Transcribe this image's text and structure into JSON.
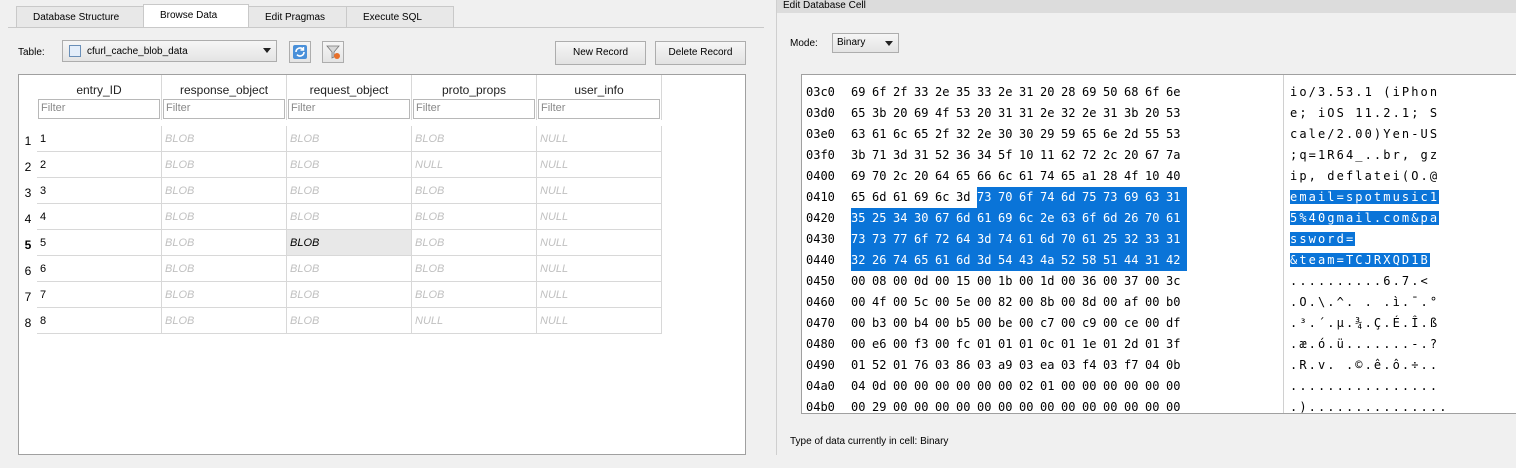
{
  "tabs": [
    "Database Structure",
    "Browse Data",
    "Edit Pragmas",
    "Execute SQL"
  ],
  "active_tab": 1,
  "toolbar": {
    "table_label": "Table:",
    "table_value": "cfurl_cache_blob_data",
    "new_record": "New Record",
    "delete_record": "Delete Record"
  },
  "grid": {
    "columns": [
      "entry_ID",
      "response_object",
      "request_object",
      "proto_props",
      "user_info"
    ],
    "filter_placeholder": "Filter",
    "rows": [
      [
        "1",
        "BLOB",
        "BLOB",
        "BLOB",
        "NULL"
      ],
      [
        "2",
        "BLOB",
        "BLOB",
        "NULL",
        "NULL"
      ],
      [
        "3",
        "BLOB",
        "BLOB",
        "BLOB",
        "NULL"
      ],
      [
        "4",
        "BLOB",
        "BLOB",
        "BLOB",
        "NULL"
      ],
      [
        "5",
        "BLOB",
        "BLOB",
        "BLOB",
        "NULL"
      ],
      [
        "6",
        "BLOB",
        "BLOB",
        "BLOB",
        "NULL"
      ],
      [
        "7",
        "BLOB",
        "BLOB",
        "BLOB",
        "NULL"
      ],
      [
        "8",
        "BLOB",
        "BLOB",
        "NULL",
        "NULL"
      ]
    ],
    "row_numbers": [
      "1",
      "2",
      "3",
      "4",
      "5",
      "6",
      "7",
      "8"
    ],
    "current_row": 4,
    "selected_cell": {
      "row": 4,
      "col": 2
    }
  },
  "edit_cell": {
    "dock_title": "Edit Database Cell",
    "mode_label": "Mode:",
    "mode_value": "Binary",
    "status_text": "Type of data currently in cell: Binary",
    "hex_rows": [
      {
        "addr": "03c0",
        "bytes": [
          "69",
          "6f",
          "2f",
          "33",
          "2e",
          "35",
          "33",
          "2e",
          "31",
          "20",
          "28",
          "69",
          "50",
          "68",
          "6f",
          "6e"
        ],
        "ascii": "io/3.53.1 (iPhon"
      },
      {
        "addr": "03d0",
        "bytes": [
          "65",
          "3b",
          "20",
          "69",
          "4f",
          "53",
          "20",
          "31",
          "31",
          "2e",
          "32",
          "2e",
          "31",
          "3b",
          "20",
          "53"
        ],
        "ascii": "e; iOS 11.2.1; S"
      },
      {
        "addr": "03e0",
        "bytes": [
          "63",
          "61",
          "6c",
          "65",
          "2f",
          "32",
          "2e",
          "30",
          "30",
          "29",
          "59",
          "65",
          "6e",
          "2d",
          "55",
          "53"
        ],
        "ascii": "cale/2.00)Yen-US"
      },
      {
        "addr": "03f0",
        "bytes": [
          "3b",
          "71",
          "3d",
          "31",
          "52",
          "36",
          "34",
          "5f",
          "10",
          "11",
          "62",
          "72",
          "2c",
          "20",
          "67",
          "7a"
        ],
        "ascii": ";q=1R64_..br, gz"
      },
      {
        "addr": "0400",
        "bytes": [
          "69",
          "70",
          "2c",
          "20",
          "64",
          "65",
          "66",
          "6c",
          "61",
          "74",
          "65",
          "a1",
          "28",
          "4f",
          "10",
          "40"
        ],
        "ascii": "ip, deflatei(O.@"
      },
      {
        "addr": "0410",
        "bytes": [
          "65",
          "6d",
          "61",
          "69",
          "6c",
          "3d",
          "73",
          "70",
          "6f",
          "74",
          "6d",
          "75",
          "73",
          "69",
          "63",
          "31"
        ],
        "ascii": "email=spotmusic1",
        "sel_from": 6
      },
      {
        "addr": "0420",
        "bytes": [
          "35",
          "25",
          "34",
          "30",
          "67",
          "6d",
          "61",
          "69",
          "6c",
          "2e",
          "63",
          "6f",
          "6d",
          "26",
          "70",
          "61"
        ],
        "ascii": "5%40gmail.com&pa",
        "sel_from": 0
      },
      {
        "addr": "0430",
        "bytes": [
          "73",
          "73",
          "77",
          "6f",
          "72",
          "64",
          "3d",
          "74",
          "61",
          "6d",
          "70",
          "61",
          "25",
          "32",
          "33",
          "31"
        ],
        "ascii": "ssword=",
        "sel_from": 0
      },
      {
        "addr": "0440",
        "bytes": [
          "32",
          "26",
          "74",
          "65",
          "61",
          "6d",
          "3d",
          "54",
          "43",
          "4a",
          "52",
          "58",
          "51",
          "44",
          "31",
          "42"
        ],
        "ascii": "&team=TCJRXQD1B",
        "sel_from": 0
      },
      {
        "addr": "0450",
        "bytes": [
          "00",
          "08",
          "00",
          "0d",
          "00",
          "15",
          "00",
          "1b",
          "00",
          "1d",
          "00",
          "36",
          "00",
          "37",
          "00",
          "3c"
        ],
        "ascii": "..........6.7.<"
      },
      {
        "addr": "0460",
        "bytes": [
          "00",
          "4f",
          "00",
          "5c",
          "00",
          "5e",
          "00",
          "82",
          "00",
          "8b",
          "00",
          "8d",
          "00",
          "af",
          "00",
          "b0"
        ],
        "ascii": ".O.\\.^. . .ì.¯.°"
      },
      {
        "addr": "0470",
        "bytes": [
          "00",
          "b3",
          "00",
          "b4",
          "00",
          "b5",
          "00",
          "be",
          "00",
          "c7",
          "00",
          "c9",
          "00",
          "ce",
          "00",
          "df"
        ],
        "ascii": ".³.´.µ.¾.Ç.É.Î.ß"
      },
      {
        "addr": "0480",
        "bytes": [
          "00",
          "e6",
          "00",
          "f3",
          "00",
          "fc",
          "01",
          "01",
          "01",
          "0c",
          "01",
          "1e",
          "01",
          "2d",
          "01",
          "3f"
        ],
        "ascii": ".æ.ó.ü.......-.?"
      },
      {
        "addr": "0490",
        "bytes": [
          "01",
          "52",
          "01",
          "76",
          "03",
          "86",
          "03",
          "a9",
          "03",
          "ea",
          "03",
          "f4",
          "03",
          "f7",
          "04",
          "0b"
        ],
        "ascii": ".R.v. .©.ê.ô.÷.."
      },
      {
        "addr": "04a0",
        "bytes": [
          "04",
          "0d",
          "00",
          "00",
          "00",
          "00",
          "00",
          "00",
          "02",
          "01",
          "00",
          "00",
          "00",
          "00",
          "00",
          "00"
        ],
        "ascii": "................"
      },
      {
        "addr": "04b0",
        "bytes": [
          "00",
          "29",
          "00",
          "00",
          "00",
          "00",
          "00",
          "00",
          "00",
          "00",
          "00",
          "00",
          "00",
          "00",
          "00",
          "00"
        ],
        "ascii": ".)..............."
      }
    ]
  }
}
